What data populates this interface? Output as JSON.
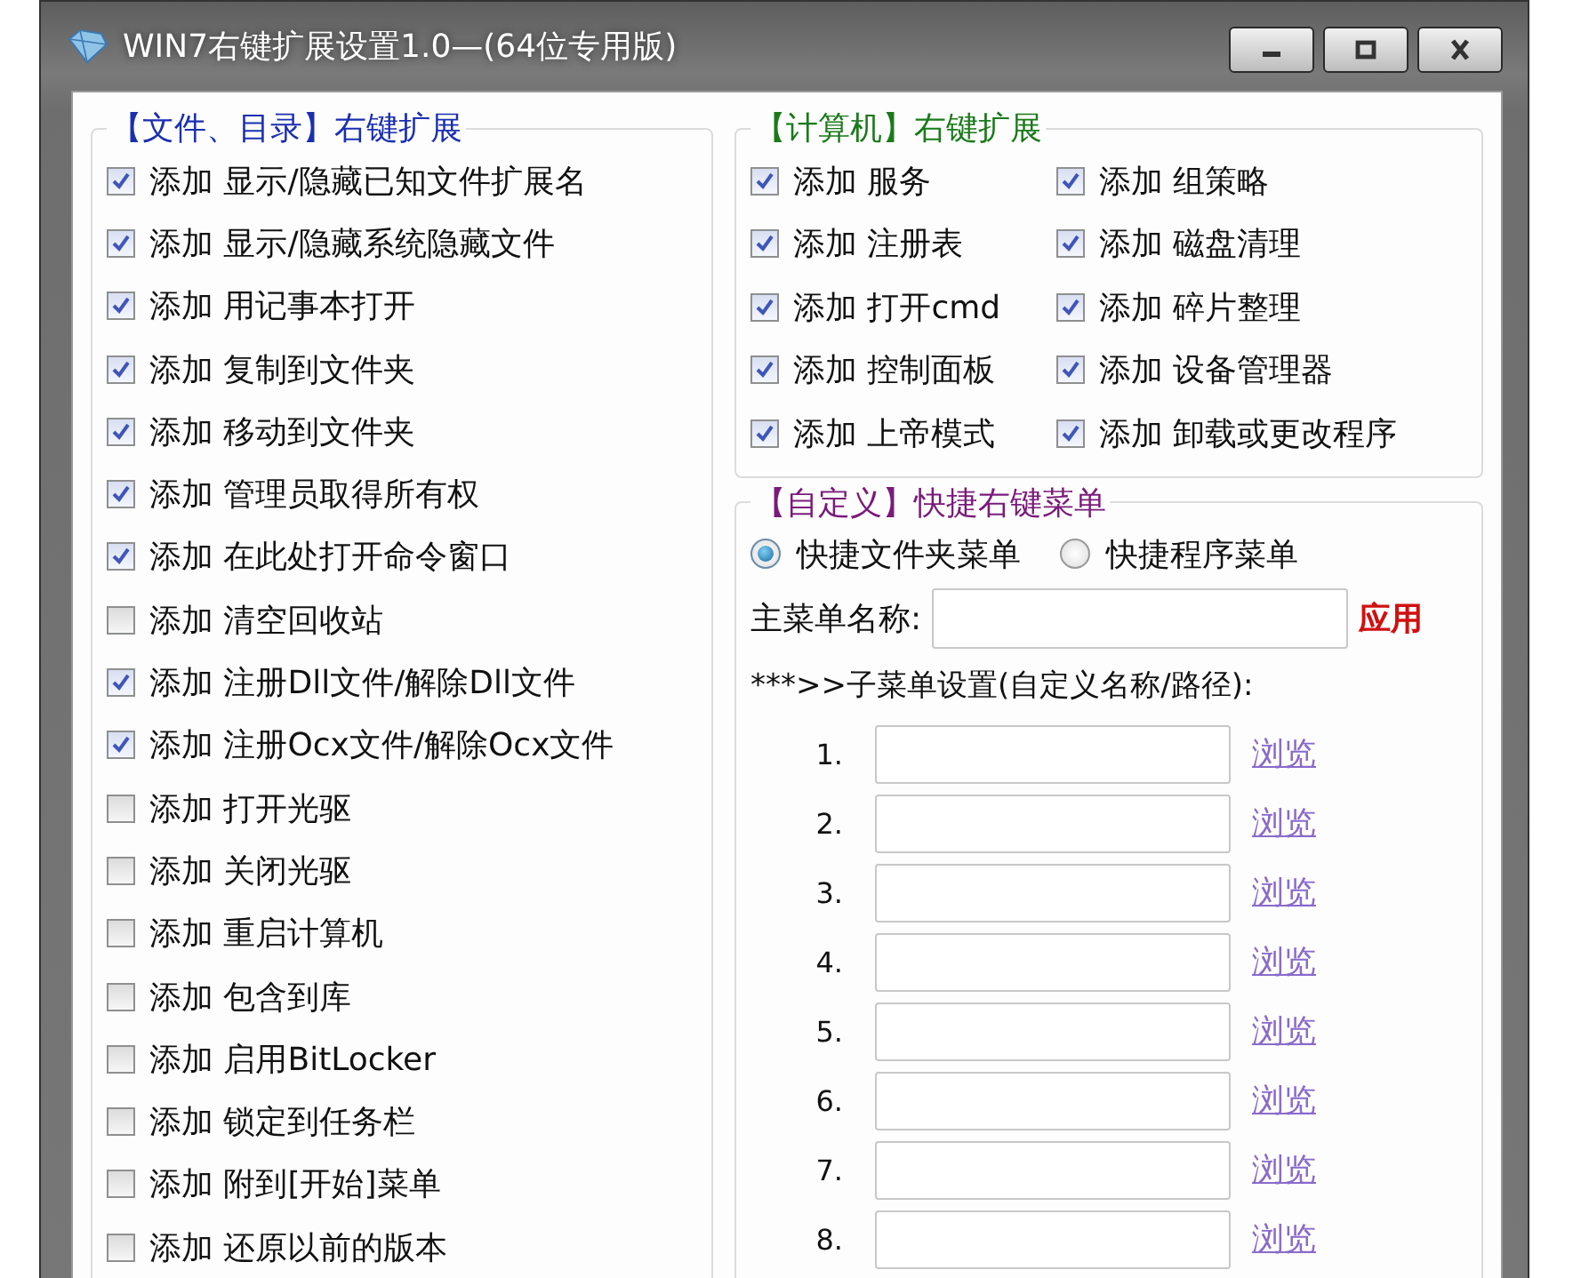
{
  "window": {
    "title": "WIN7右键扩展设置1.0—(64位专用版)"
  },
  "file_group": {
    "title": "【文件、目录】右键扩展",
    "items": [
      {
        "label": "添加 显示/隐藏已知文件扩展名",
        "checked": true
      },
      {
        "label": "添加 显示/隐藏系统隐藏文件",
        "checked": true
      },
      {
        "label": "添加 用记事本打开",
        "checked": true
      },
      {
        "label": "添加 复制到文件夹",
        "checked": true
      },
      {
        "label": "添加 移动到文件夹",
        "checked": true
      },
      {
        "label": "添加 管理员取得所有权",
        "checked": true
      },
      {
        "label": "添加 在此处打开命令窗口",
        "checked": true
      },
      {
        "label": "添加 清空回收站",
        "checked": false
      },
      {
        "label": "添加 注册Dll文件/解除Dll文件",
        "checked": true
      },
      {
        "label": "添加 注册Ocx文件/解除Ocx文件",
        "checked": true
      },
      {
        "label": "添加 打开光驱",
        "checked": false
      },
      {
        "label": "添加 关闭光驱",
        "checked": false
      },
      {
        "label": "添加 重启计算机",
        "checked": false
      },
      {
        "label": "添加 包含到库",
        "checked": false
      },
      {
        "label": "添加 启用BitLocker",
        "checked": false
      },
      {
        "label": "添加 锁定到任务栏",
        "checked": false
      },
      {
        "label": "添加 附到[开始]菜单",
        "checked": false
      },
      {
        "label": "添加 还原以前的版本",
        "checked": false
      }
    ]
  },
  "computer_group": {
    "title": "【计算机】右键扩展",
    "items": [
      {
        "label": "添加 服务",
        "checked": true
      },
      {
        "label": "添加 组策略",
        "checked": true
      },
      {
        "label": "添加 注册表",
        "checked": true
      },
      {
        "label": "添加 磁盘清理",
        "checked": true
      },
      {
        "label": "添加 打开cmd",
        "checked": true
      },
      {
        "label": "添加 碎片整理",
        "checked": true
      },
      {
        "label": "添加 控制面板",
        "checked": true
      },
      {
        "label": "添加 设备管理器",
        "checked": true
      },
      {
        "label": "添加 上帝模式",
        "checked": true
      },
      {
        "label": "添加 卸载或更改程序",
        "checked": true
      }
    ]
  },
  "custom_group": {
    "title": "【自定义】快捷右键菜单",
    "menu_types": [
      {
        "label": "快捷文件夹菜单",
        "selected": true
      },
      {
        "label": "快捷程序菜单",
        "selected": false
      }
    ],
    "main_menu_label": "主菜单名称:",
    "apply_button": "应用",
    "submenu_heading": "***>>子菜单设置(自定义名称/路径):",
    "submenus": [
      {
        "number": "1.",
        "browse": "浏览"
      },
      {
        "number": "2.",
        "browse": "浏览"
      },
      {
        "number": "3.",
        "browse": "浏览"
      },
      {
        "number": "4.",
        "browse": "浏览"
      },
      {
        "number": "5.",
        "browse": "浏览"
      },
      {
        "number": "6.",
        "browse": "浏览"
      },
      {
        "number": "7.",
        "browse": "浏览"
      },
      {
        "number": "8.",
        "browse": "浏览"
      }
    ]
  }
}
